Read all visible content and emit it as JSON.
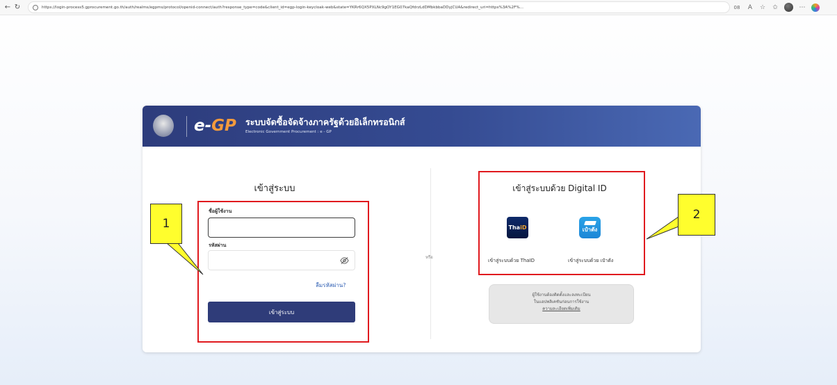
{
  "browser": {
    "url": "https://login-process5.gprocurement.go.th/auth/realms/egpms/protocol/openid-connect/auth?response_type=code&client_id=egp-login-keycloak-web&state=YKRr6QX5PXLNc9gOY1EG07kaQfdrzLdDMbkbbaDDyjCUA&redirect_uri=https%3A%2F%...",
    "zoom": "08"
  },
  "header": {
    "logo_e": "e-",
    "logo_gp": "GP",
    "title": "ระบบจัดซื้อจัดจ้างภาครัฐด้วยอิเล็กทรอนิกส์",
    "subtitle": "Electronic Government Procurement : e - GP"
  },
  "login": {
    "title": "เข้าสู่ระบบ",
    "username_label": "ชื่อผู้ใช้งาน",
    "username_value": "",
    "password_label": "รหัสผ่าน",
    "password_value": "",
    "forgot_link": "ลืมรหัสผ่าน?",
    "submit_label": "เข้าสู่ระบบ"
  },
  "or_label": "หรือ",
  "digital_id": {
    "title": "เข้าสู่ระบบด้วย Digital ID",
    "thaid_icon_text_1": "Tha",
    "thaid_icon_text_2": "iD",
    "thaid_label": "เข้าสู่ระบบด้วย ThaID",
    "paotang_icon_text": "เป๋าตัง",
    "paotang_label": "เข้าสู่ระบบด้วย เป๋าตัง",
    "info_line_1": "ผู้ใช้งานต้องติดตั้งและลงทะเบียน",
    "info_line_2": "ในแอปพลิเคชันก่อนการใช้งาน",
    "info_link": "ความละเอียดเพิ่มเติม"
  },
  "annotations": {
    "callout_1": "1",
    "callout_2": "2",
    "highlight_color": "#e0191e",
    "callout_color": "#fffe2d"
  },
  "colors": {
    "header_blue": "#2d3c7c",
    "button_blue": "#2f3c79",
    "link_blue": "#2f5fb3",
    "logo_orange": "#f39a3c"
  }
}
